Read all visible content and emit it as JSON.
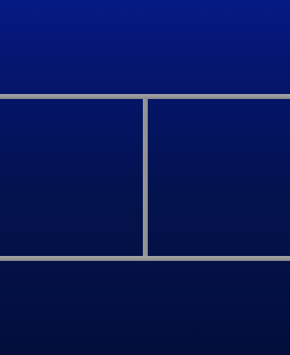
{
  "colors": {
    "background_top": "#051a85",
    "background_bottom": "#030e3c",
    "divider": "#9a9a9a"
  }
}
